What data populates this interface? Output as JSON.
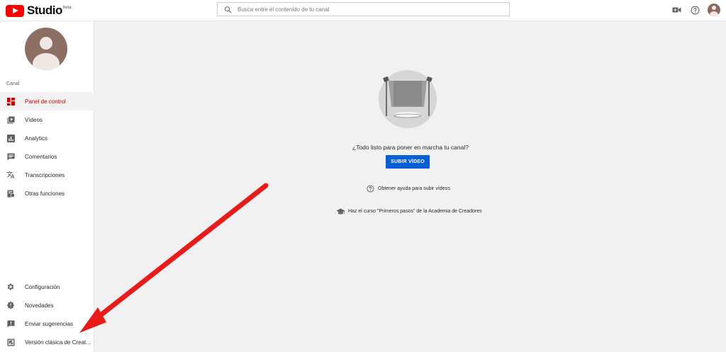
{
  "header": {
    "logo_text": "Studio",
    "logo_badge": "beta",
    "search_placeholder": "Busca entre el contenido de tu canal"
  },
  "sidebar": {
    "channel_label": "Canal",
    "items": [
      {
        "label": "Panel de control",
        "icon": "dashboard-icon",
        "active": true
      },
      {
        "label": "Vídeos",
        "icon": "videos-icon"
      },
      {
        "label": "Analytics",
        "icon": "analytics-icon"
      },
      {
        "label": "Comentarios",
        "icon": "comments-icon"
      },
      {
        "label": "Transcripciones",
        "icon": "translate-icon"
      },
      {
        "label": "Otras funciones",
        "icon": "other-features-icon"
      }
    ],
    "bottom_items": [
      {
        "label": "Configuración",
        "icon": "gear-icon"
      },
      {
        "label": "Novedades",
        "icon": "alert-badge-icon"
      },
      {
        "label": "Enviar sugerencias",
        "icon": "feedback-icon"
      },
      {
        "label": "Versión clásica de Creat…",
        "icon": "classic-studio-icon"
      }
    ]
  },
  "main": {
    "prompt": "¿Todo listo para poner en marcha tu canal?",
    "upload_label": "SUBIR VÍDEO",
    "help_link": "Obtener ayuda para subir vídeos",
    "course_link": "Haz el curso \"Primeros pasos\" de la Academia de Creadores"
  },
  "colors": {
    "accent": "#065fd4",
    "active_nav": "#cc0000",
    "brand_red": "#ff0000",
    "annotation_red": "#e81a1a"
  }
}
